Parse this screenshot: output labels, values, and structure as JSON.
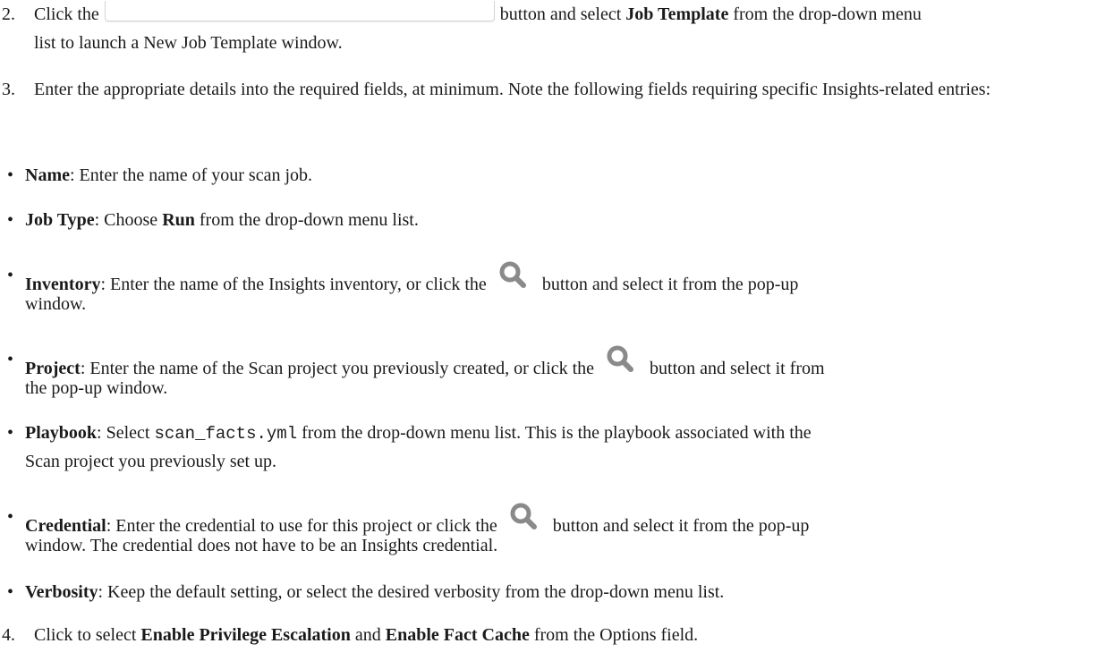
{
  "step2": {
    "number": "2.",
    "before_button": "Click the",
    "after_button": "button and select",
    "bold": "Job Template",
    "after_bold": "from the drop-down menu",
    "line2": "list to launch a New Job Template window."
  },
  "step3": {
    "number": "3.",
    "text": "Enter the appropriate details into the required fields, at minimum. Note the following fields requiring specific Insights-related entries:"
  },
  "bullets": {
    "name": {
      "label": "Name",
      "text": ": Enter the name of your scan job."
    },
    "job_type": {
      "label": "Job Type",
      "before": ": Choose ",
      "bold": "Run",
      "after": " from the drop-down menu list."
    },
    "inventory": {
      "label": "Inventory",
      "before": ": Enter the name of the Insights inventory, or click the",
      "after": "button and select it from the pop-up",
      "line2": "window."
    },
    "project": {
      "label": "Project",
      "before": ": Enter the name of the Scan project you previously created, or click the",
      "after": "button and select it from",
      "line2": "the pop-up window."
    },
    "playbook": {
      "label": "Playbook",
      "before": ": Select ",
      "code": "scan_facts.yml",
      "after": " from the drop-down menu list. This is the playbook associated with the",
      "line2": "Scan project you previously set up."
    },
    "credential": {
      "label": "Credential",
      "before": ": Enter the credential to use for this project or click the",
      "after": "button and select it from the pop-up",
      "line2": "window. The credential does not have to be an Insights credential."
    },
    "verbosity": {
      "label": "Verbosity",
      "text": ": Keep the default setting, or select the desired verbosity from the drop-down menu list."
    }
  },
  "step4": {
    "number": "4.",
    "before": "Click to select ",
    "bold1": "Enable Privilege Escalation",
    "mid": " and ",
    "bold2": "Enable Fact Cache",
    "after": " from the Options field."
  },
  "bullet_char": "•",
  "colors": {
    "icon": "#8a8a8a",
    "text": "#1a1a1a"
  }
}
